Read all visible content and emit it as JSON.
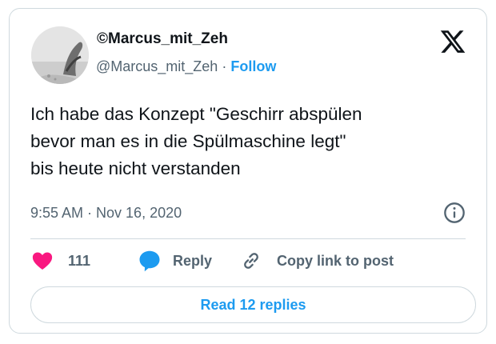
{
  "author": {
    "name": "©Marcus_mit_Zeh",
    "handle": "@Marcus_mit_Zeh",
    "separator": " · ",
    "follow_label": "Follow"
  },
  "tweet": {
    "lines": [
      "Ich habe das Konzept \"Geschirr abspülen",
      "bevor man es in die Spülmaschine legt\"",
      "bis heute nicht verstanden"
    ],
    "timestamp": "9:55 AM · Nov 16, 2020"
  },
  "actions": {
    "like_count": "111",
    "reply_label": "Reply",
    "copy_label": "Copy link to post"
  },
  "read_replies_label": "Read 12 replies",
  "colors": {
    "accent": "#1d9bf0",
    "like": "#f91880",
    "secondary_text": "#536471",
    "border": "#cfd9de"
  },
  "icons": [
    "x-logo-icon",
    "info-icon",
    "heart-icon",
    "reply-bubble-icon",
    "link-icon"
  ]
}
